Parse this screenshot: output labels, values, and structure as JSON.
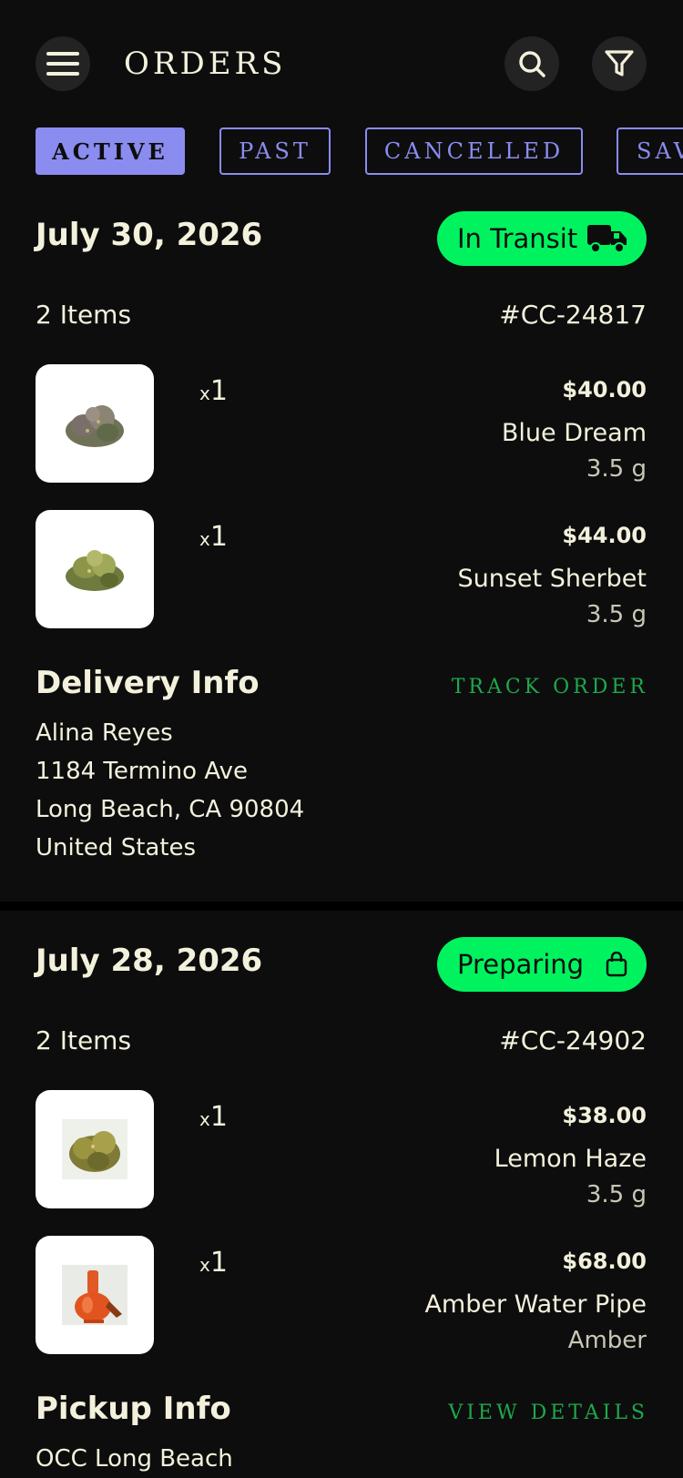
{
  "header": {
    "title": "ORDERS",
    "menu_icon": "hamburger-menu-icon",
    "search_icon": "search-icon",
    "filter_icon": "filter-icon"
  },
  "tabs": [
    {
      "label": "ACTIVE",
      "selected": true
    },
    {
      "label": "PAST",
      "selected": false
    },
    {
      "label": "CANCELLED",
      "selected": false
    },
    {
      "label": "SAV",
      "selected": false
    }
  ],
  "colors": {
    "background": "#0d0d0d",
    "text": "#f3f1dc",
    "tab_accent": "#8a8cf0",
    "status_green": "#00f35f",
    "link_green": "#1ea84b"
  },
  "orders": [
    {
      "date": "July 30, 2026",
      "status": "In Transit",
      "status_icon": "truck-icon",
      "items_count": "2 Items",
      "order_id": "#CC-24817",
      "items": [
        {
          "qty_prefix": "x",
          "qty": "1",
          "price": "$40.00",
          "name": "Blue Dream",
          "detail": "3.5 g",
          "image": "cannabis-flower-image"
        },
        {
          "qty_prefix": "x",
          "qty": "1",
          "price": "$44.00",
          "name": "Sunset Sherbet",
          "detail": "3.5 g",
          "image": "cannabis-flower-image"
        }
      ],
      "info_title": "Delivery Info",
      "info_link": "TRACK ORDER",
      "address": [
        "Alina Reyes",
        "1184 Termino Ave",
        "Long Beach, CA 90804",
        "United States"
      ]
    },
    {
      "date": "July 28, 2026",
      "status": "Preparing",
      "status_icon": "shopping-bag-icon",
      "items_count": "2 Items",
      "order_id": "#CC-24902",
      "items": [
        {
          "qty_prefix": "x",
          "qty": "1",
          "price": "$38.00",
          "name": "Lemon Haze",
          "detail": "3.5 g",
          "image": "cannabis-flower-image"
        },
        {
          "qty_prefix": "x",
          "qty": "1",
          "price": "$68.00",
          "name": "Amber Water Pipe",
          "detail": "Amber",
          "image": "water-pipe-image"
        }
      ],
      "info_title": "Pickup Info",
      "info_link": "VIEW DETAILS",
      "address": [
        "OCC Long Beach"
      ]
    }
  ]
}
